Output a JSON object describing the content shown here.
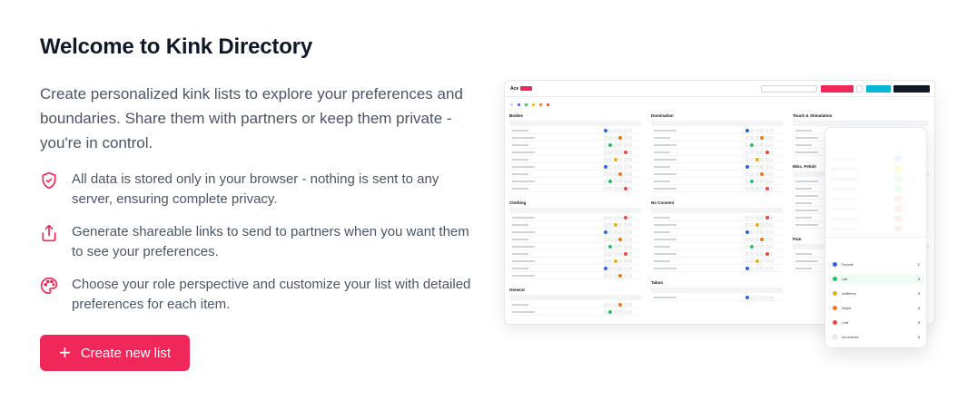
{
  "hero": {
    "title": "Welcome to Kink Directory",
    "intro": "Create personalized kink lists to explore your preferences and boundaries. Share them with partners or keep them private - you're in control."
  },
  "features": [
    {
      "icon": "shield-check-icon",
      "text": "All data is stored only in your browser - nothing is sent to any server, ensuring complete privacy."
    },
    {
      "icon": "share-upload-icon",
      "text": "Generate shareable links to send to partners when you want them to see your preferences."
    },
    {
      "icon": "palette-icon",
      "text": "Choose your role perspective and customize your list with detailed preferences for each item."
    }
  ],
  "cta": {
    "label": "Create new list",
    "icon": "plus-icon"
  },
  "colors": {
    "accent": "#f0285a",
    "favorite": "#2563eb",
    "like": "#22c55e",
    "indifferent": "#eab308",
    "maybe": "#f97316",
    "limit": "#ef4444"
  },
  "preview": {
    "sections": [
      "Bodies",
      "Clothing",
      "General",
      "Domination",
      "No Consent",
      "Taboo",
      "Touch & Stimulation",
      "Misc. Fetish",
      "Pain"
    ],
    "popover_ratings": [
      "Favorite",
      "Like",
      "Indifferent",
      "Maybe",
      "Limit",
      "Not entered"
    ]
  }
}
